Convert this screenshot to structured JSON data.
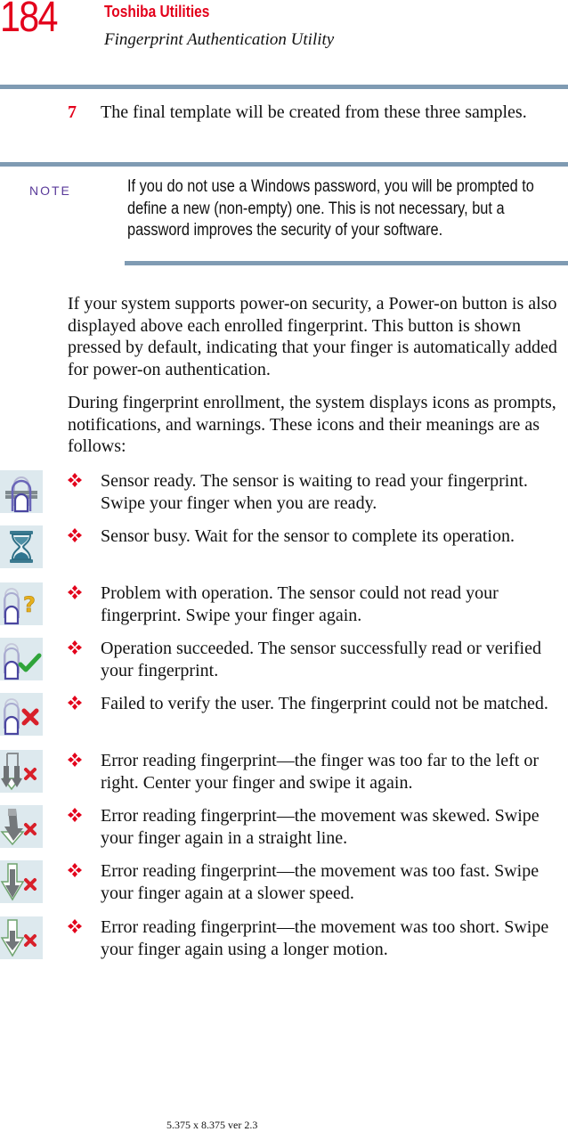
{
  "header": {
    "page_number": "184",
    "section_title": "Toshiba Utilities",
    "subsection_title": "Fingerprint Authentication Utility"
  },
  "step": {
    "number": "7",
    "text": "The final template will be created from these three samples."
  },
  "note": {
    "label": "NOTE",
    "text": "If you do not use a Windows password, you will be prompted to define a new (non-empty) one. This is not necessary, but a password improves the security of your software."
  },
  "paragraphs": [
    "If your system supports power-on security, a Power-on button is also displayed above each enrolled fingerprint. This button is shown pressed by default, indicating that your finger is automatically added for power-on authentication.",
    "During fingerprint enrollment, the system displays icons as prompts, notifications, and warnings. These icons and their meanings are as follows:"
  ],
  "icon_list": [
    {
      "icon": "sensor-ready-icon",
      "text": "Sensor ready. The sensor is waiting to read your fingerprint. Swipe your finger when you are ready."
    },
    {
      "icon": "hourglass-icon",
      "text": "Sensor busy. Wait for the sensor to complete its operation."
    },
    {
      "icon": "finger-question-icon",
      "text": "Problem with operation. The sensor could not read your fingerprint. Swipe your finger again."
    },
    {
      "icon": "finger-check-icon",
      "text": "Operation succeeded. The sensor successfully read or verified your fingerprint."
    },
    {
      "icon": "finger-x-icon",
      "text": "Failed to verify the user. The fingerprint could not be matched."
    },
    {
      "icon": "double-arrow-x-icon",
      "text": "Error reading fingerprint—the finger was too far to the left or right. Center your finger and swipe it again."
    },
    {
      "icon": "skewed-arrow-x-icon",
      "text": "Error reading fingerprint—the movement was skewed. Swipe your finger again in a straight line."
    },
    {
      "icon": "fast-arrow-x-icon",
      "text": "Error reading fingerprint—the movement was too fast. Swipe your finger again at a slower speed."
    },
    {
      "icon": "short-arrow-x-icon",
      "text": "Error reading fingerprint—the movement was too short. Swipe your finger again using a longer motion."
    }
  ],
  "footer": {
    "text": "5.375 x 8.375 ver 2.3"
  },
  "colors": {
    "accent_red": "#e3001b",
    "rule_blue_gray": "#7f9bb3",
    "note_label_purple": "#5a3a9a",
    "icon_background": "#dde9ee"
  }
}
